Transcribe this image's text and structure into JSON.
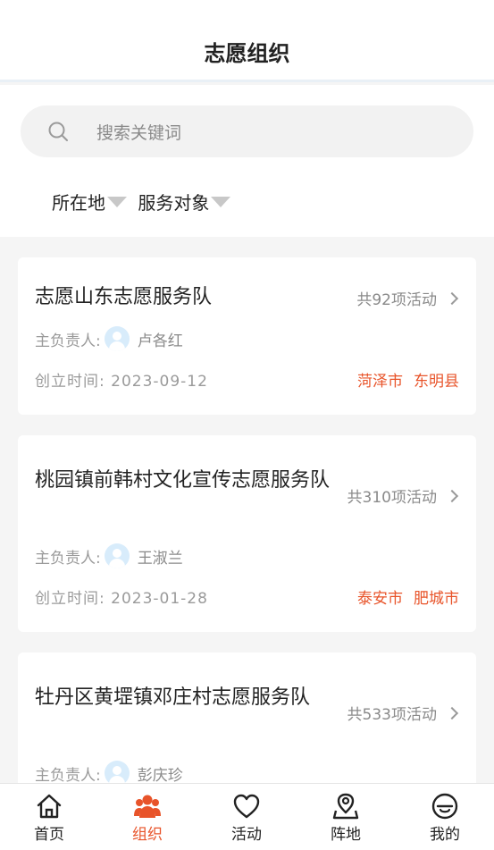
{
  "header": {
    "title": "志愿组织"
  },
  "search": {
    "placeholder": "搜索关键词"
  },
  "filters": [
    {
      "label": "所在地"
    },
    {
      "label": "服务对象"
    }
  ],
  "labels": {
    "leader_prefix": "主负责人:",
    "date_prefix": "创立时间:"
  },
  "organizations": [
    {
      "name": "志愿山东志愿服务队",
      "count": "共92项活动",
      "leader": "卢各红",
      "date": "2023-09-12",
      "city": "菏泽市",
      "county": "东明县"
    },
    {
      "name": "桃园镇前韩村文化宣传志愿服务队",
      "count": "共310项活动",
      "leader": "王淑兰",
      "date": "2023-01-28",
      "city": "泰安市",
      "county": "肥城市"
    },
    {
      "name": "牡丹区黄堽镇邓庄村志愿服务队",
      "count": "共533项活动",
      "leader": "彭庆珍",
      "date": "",
      "city": "",
      "county": ""
    }
  ],
  "tabbar": [
    {
      "label": "首页",
      "icon": "home-icon"
    },
    {
      "label": "组织",
      "icon": "group-icon",
      "active": true
    },
    {
      "label": "活动",
      "icon": "heart-icon"
    },
    {
      "label": "阵地",
      "icon": "map-pin-icon"
    },
    {
      "label": "我的",
      "icon": "profile-icon"
    }
  ],
  "colors": {
    "accent": "#e8542a",
    "background": "#f5f5f5"
  }
}
